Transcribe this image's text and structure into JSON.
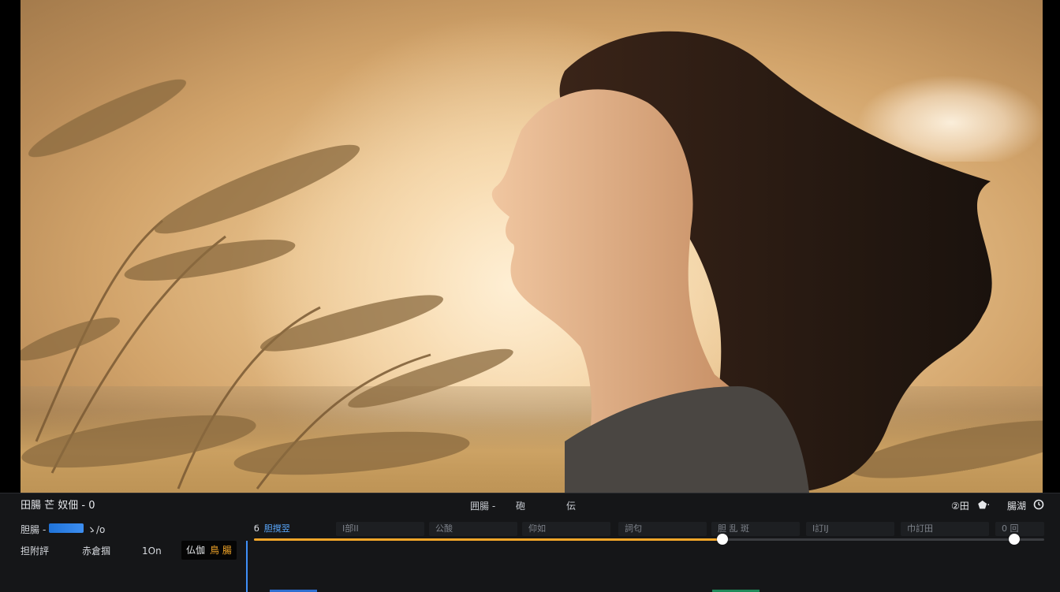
{
  "window": {
    "project_title": "田腸 芒 奴佃 - 0"
  },
  "toolbar": {
    "menu_a": "囲腸 -",
    "menu_b": "砲",
    "menu_c": "伝",
    "zoom_label": "②田",
    "shape_label": "⬟·",
    "grid_label": "腸湖"
  },
  "track": {
    "label_lead": "胆腸",
    "label_rest": "-",
    "value_tail": "ゝ/о"
  },
  "ruler": {
    "current_lead": "б",
    "current_time": "胆撹翌",
    "ticks": [
      "I部II",
      "公酸",
      "仰如",
      "詞匂",
      "胆 乱 斑",
      "I訂IJ",
      "巾訂田",
      "0 回"
    ]
  },
  "controls": {
    "a": "担附評",
    "b": "赤倉掴",
    "c": "1On",
    "d": "仏伽",
    "d_accent": "鳥 腸"
  },
  "playback": {
    "progress": 0.593,
    "end_marker": 0.962
  },
  "colors": {
    "accent": "#f3a629",
    "playhead": "#3f8ff7",
    "track_field": "#2a7fe6",
    "panel_bg": "#151618"
  },
  "clips": [
    {
      "start": 0.02,
      "end": 0.08,
      "color": "#2f6fd0"
    },
    {
      "start": 0.58,
      "end": 0.64,
      "color": "#1f8a5a"
    }
  ]
}
